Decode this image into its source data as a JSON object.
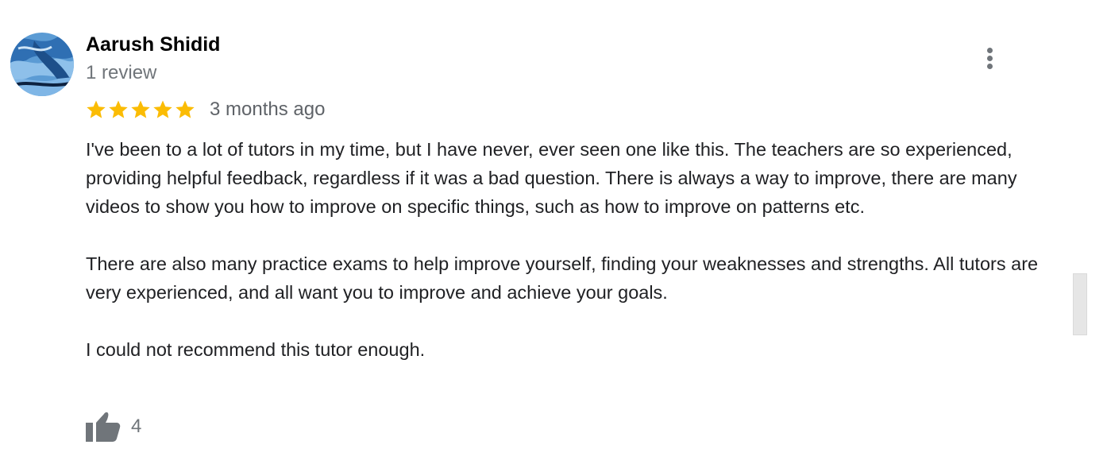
{
  "review": {
    "author_name": "Aarush Shidid",
    "review_count": "1 review",
    "rating": 5,
    "max_rating": 5,
    "time_ago": "3 months ago",
    "paragraphs": [
      "I've been to a lot of tutors in my time, but I have never, ever seen one like this. The teachers are so experienced, providing helpful feedback, regardless if it was a bad question. There is always a way to improve, there are many videos to show you how to improve on specific things, such as how to improve on patterns etc.",
      "There are also many practice exams to help improve yourself, finding your weaknesses and strengths. All tutors are very experienced, and all want you to improve and achieve your goals.",
      "I could not recommend this tutor enough."
    ],
    "like_count": "4"
  },
  "icons": {
    "avatar": "avatar-photo",
    "more": "more-vert-icon",
    "star": "star-icon",
    "like": "thumbs-up-icon"
  },
  "colors": {
    "star": "#fbbc04",
    "name": "#000000",
    "secondary_text": "#70757a",
    "body_text": "#202124",
    "icon_gray": "#70757a"
  }
}
